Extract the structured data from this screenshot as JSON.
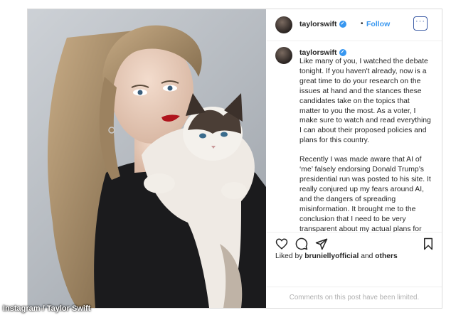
{
  "post": {
    "username": "taylorswift",
    "follow_label": "Follow",
    "separator": "•",
    "more_label": "···",
    "caption_paragraphs": [
      "Like many of you, I watched the debate tonight. If you haven't already, now is a great time to do your research on the issues at hand and the stances these candidates take on the topics that matter to you the most. As a voter, I make sure to watch and read everything I can about their proposed policies and plans for this country.",
      "Recently I was made aware that AI of ‘me’ falsely endorsing Donald Trump’s presidential run was posted to his site. It really conjured up my fears around AI, and the dangers of spreading misinformation. It brought me to the conclusion that I need to be very transparent about my actual plans for this election as a voter. The simplest way to combat misinformation is with"
    ],
    "likes_prefix": "Liked by ",
    "likes_user": "bruniellyofficial",
    "likes_and": " and ",
    "likes_others": "others",
    "comments_notice": "Comments on this post have been limited."
  },
  "credit": "Instagram / Taylor Swift",
  "icons": {
    "verified": "verified-badge-icon",
    "like": "heart-icon",
    "comment": "comment-icon",
    "share": "send-icon",
    "save": "bookmark-icon",
    "more": "more-options-icon"
  },
  "colors": {
    "accent_blue": "#3897f0",
    "border": "#dbdbdb",
    "muted_text": "#b0b0b0"
  }
}
